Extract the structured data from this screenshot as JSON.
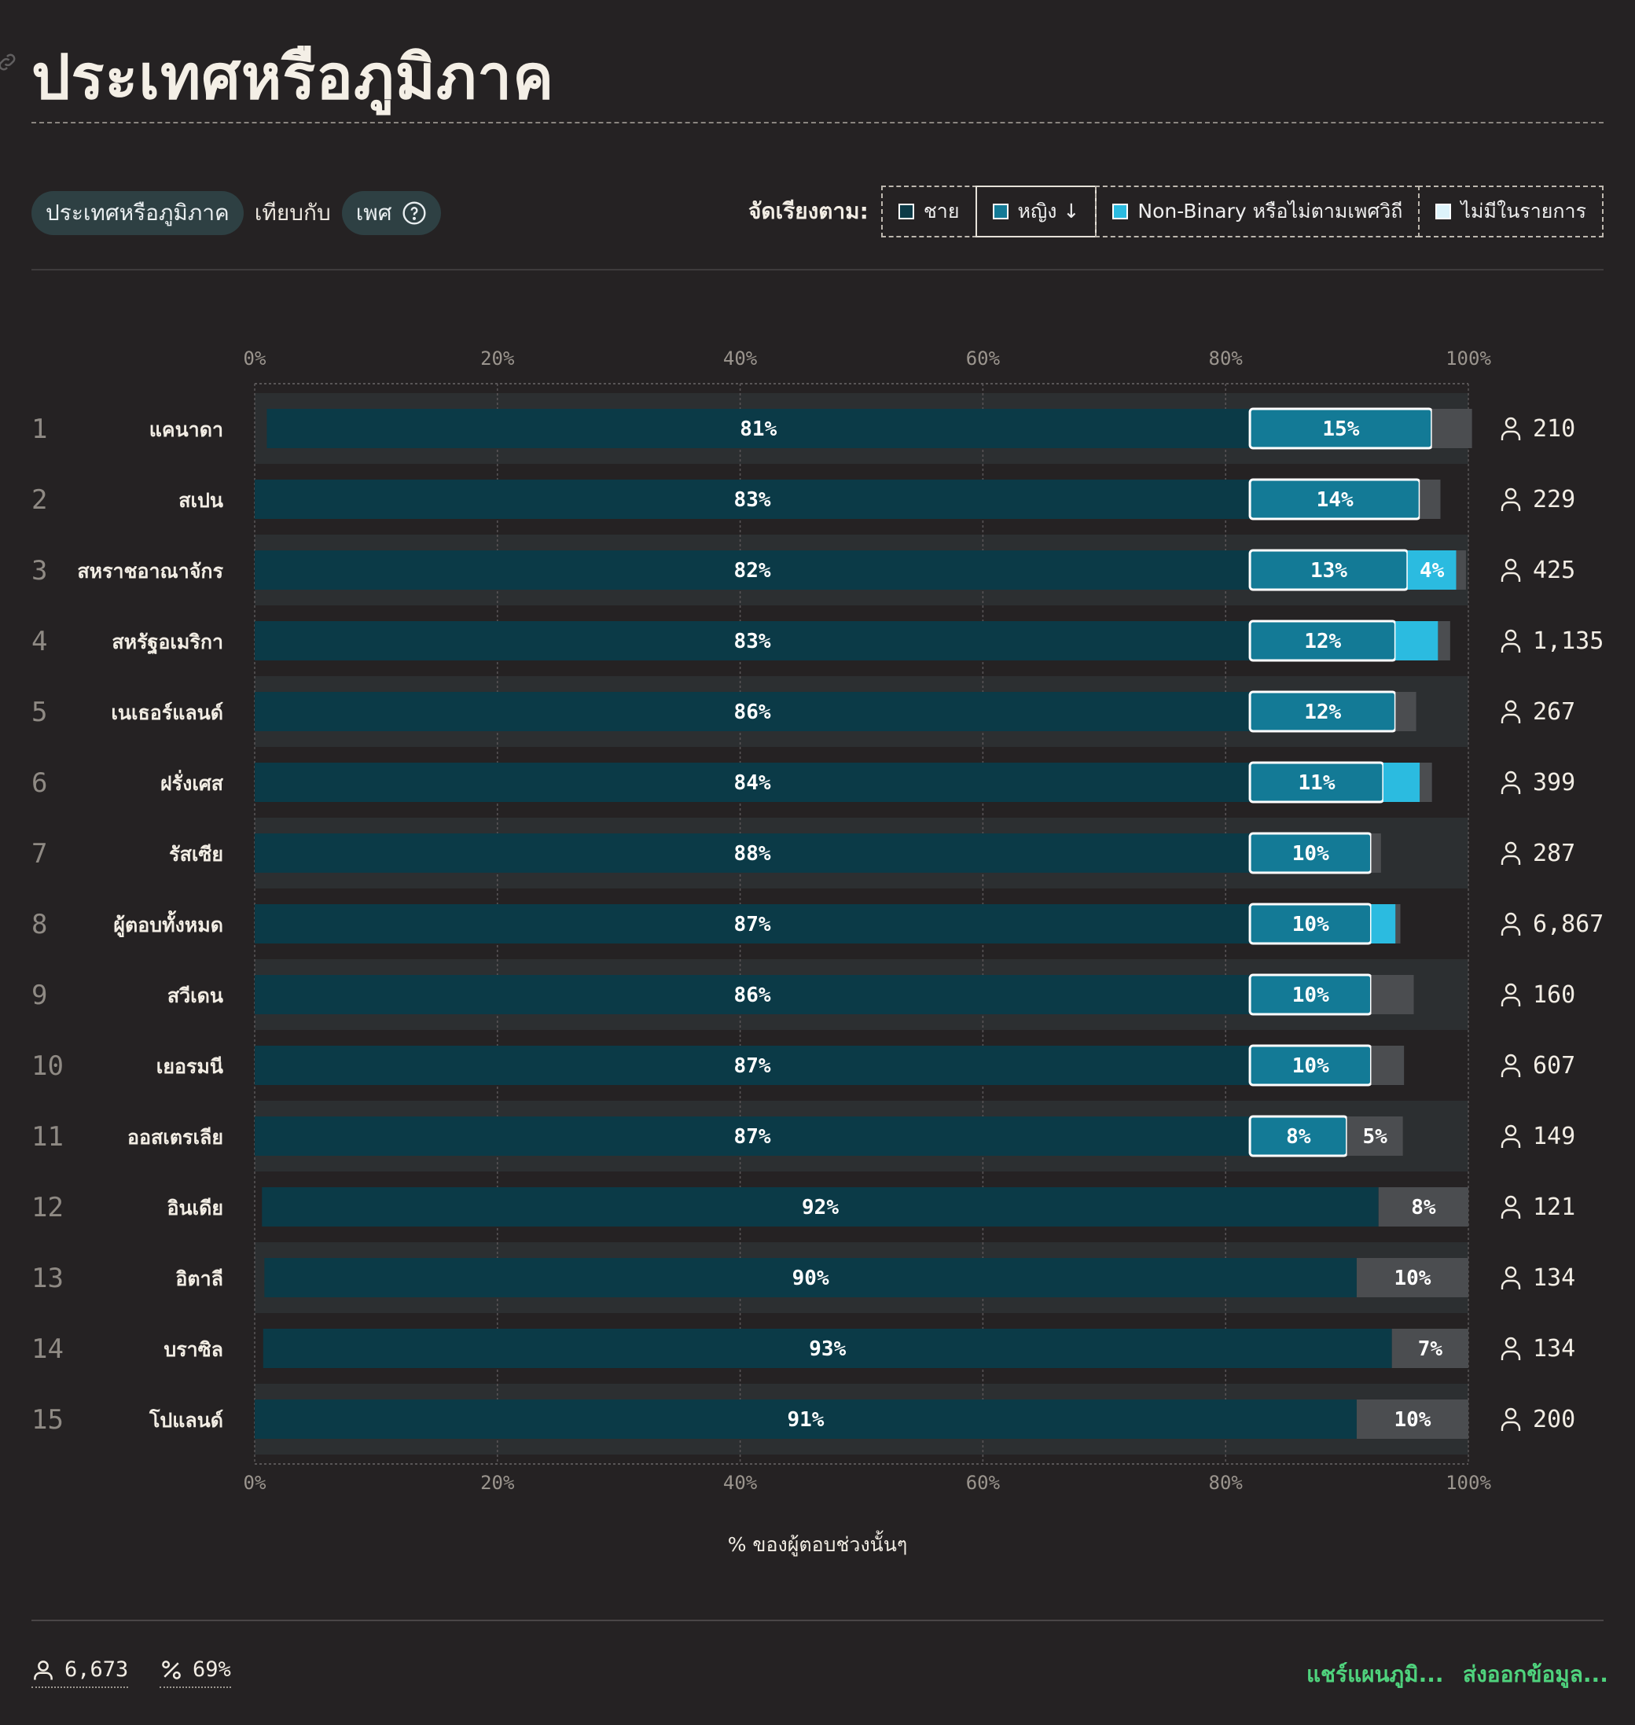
{
  "header": {
    "title": "ประเทศหรือภูมิภาค"
  },
  "controls": {
    "dimension_pill": "ประเทศหรือภูมิภาค",
    "versus_label": "เทียบกับ",
    "compare_pill": "เพศ"
  },
  "sort": {
    "label": "จัดเรียงตาม:",
    "options": [
      {
        "label": "ชาย",
        "color": "#0b3a47"
      },
      {
        "label": "หญิง ↓",
        "color": "#137a96",
        "active": true
      },
      {
        "label": "Non-Binary หรือไม่ตามเพศวิถี",
        "color": "#2bbbe0"
      },
      {
        "label": "ไม่มีในรายการ",
        "color": "#ddf3fa"
      }
    ]
  },
  "chart_data": {
    "type": "bar",
    "stacked": true,
    "orientation": "horizontal",
    "xlabel": "% ของผู้ตอบช่วงนั้นๆ",
    "xlim": [
      0,
      100
    ],
    "ticks": [
      "0%",
      "20%",
      "40%",
      "60%",
      "80%",
      "100%"
    ],
    "rank_labels": [
      "1",
      "2",
      "3",
      "4",
      "5",
      "6",
      "7",
      "8",
      "9",
      "10",
      "11",
      "12",
      "13",
      "14",
      "15"
    ],
    "categories": [
      "แคนาดา",
      "สเปน",
      "สหราชอาณาจักร",
      "สหรัฐอเมริกา",
      "เนเธอร์แลนด์",
      "ฝรั่งเศส",
      "รัสเซีย",
      "ผู้ตอบทั้งหมด",
      "สวีเดน",
      "เยอรมนี",
      "ออสเตรเลีย",
      "อินเดีย",
      "อิตาลี",
      "บราซิล",
      "โปแลนด์"
    ],
    "respondents": [
      "210",
      "229",
      "425",
      "1,135",
      "267",
      "399",
      "287",
      "6,867",
      "160",
      "607",
      "149",
      "121",
      "134",
      "134",
      "200"
    ],
    "series": [
      {
        "name": "ชาย",
        "color": "#0b3a47",
        "values": [
          81,
          83,
          82,
          83,
          86,
          84,
          88,
          87,
          86,
          87,
          87,
          92,
          90,
          93,
          91
        ],
        "labels": [
          "81%",
          "83%",
          "82%",
          "83%",
          "86%",
          "84%",
          "88%",
          "87%",
          "86%",
          "87%",
          "87%",
          "92%",
          "90%",
          "93%",
          "91%"
        ]
      },
      {
        "name": "หญิง",
        "color": "#137a96",
        "values": [
          15,
          14,
          13,
          12,
          12,
          11,
          10,
          10,
          10,
          10,
          8,
          0,
          0,
          0,
          0
        ],
        "labels": [
          "15%",
          "14%",
          "13%",
          "12%",
          "12%",
          "11%",
          "10%",
          "10%",
          "10%",
          "10%",
          "8%",
          "",
          "",
          "",
          ""
        ]
      },
      {
        "name": "Non-Binary หรือไม่ตามเพศวิถี",
        "color": "#2bbbe0",
        "values": [
          0,
          0,
          4,
          3.5,
          0,
          3,
          0,
          2,
          0,
          0,
          0,
          0,
          0,
          0,
          0
        ],
        "labels": [
          "",
          "",
          "4%",
          "",
          "",
          "",
          "",
          "",
          "",
          "",
          "",
          "",
          "",
          "",
          ""
        ]
      },
      {
        "name": "ไม่มีในรายการ",
        "color": "#4b4d50",
        "values": [
          3.3,
          1.7,
          0.8,
          1,
          1.7,
          1,
          0.8,
          0.4,
          3.5,
          2.7,
          4.6,
          7.4,
          9.2,
          6.3,
          9.2
        ],
        "labels": [
          "",
          "",
          "",
          "",
          "",
          "",
          "",
          "",
          "",
          "",
          "5%",
          "8%",
          "10%",
          "7%",
          "10%"
        ]
      }
    ]
  },
  "footer": {
    "respondents": "6,673",
    "percent": "69%",
    "share_link": "แชร์แผนภูมิ...",
    "export_link": "ส่งออกข้อมูล..."
  }
}
